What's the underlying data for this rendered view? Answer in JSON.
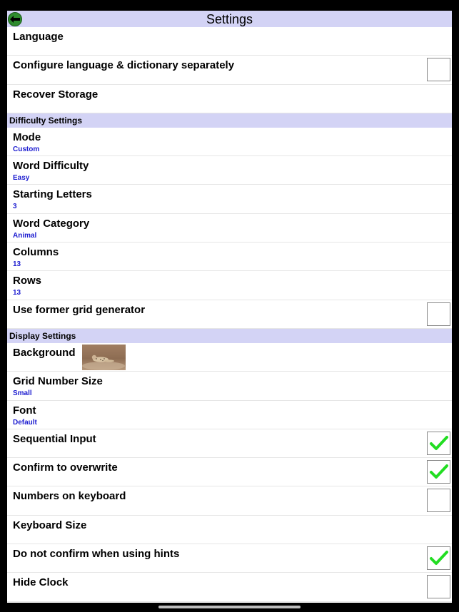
{
  "header": {
    "title": "Settings"
  },
  "sections": [
    {
      "header": "",
      "rows": [
        {
          "label": "Language"
        },
        {
          "label": "Configure language & dictionary separately",
          "checkbox": false
        },
        {
          "label": "Recover Storage"
        }
      ]
    },
    {
      "header": "Difficulty Settings",
      "rows": [
        {
          "label": "Mode",
          "value": "Custom"
        },
        {
          "label": "Word Difficulty",
          "value": "Easy"
        },
        {
          "label": "Starting Letters",
          "value": "3"
        },
        {
          "label": "Word Category",
          "value": "Animal"
        },
        {
          "label": "Columns",
          "value": "13"
        },
        {
          "label": "Rows",
          "value": "13"
        },
        {
          "label": "Use former grid generator",
          "checkbox": false
        }
      ]
    },
    {
      "header": "Display Settings",
      "rows": [
        {
          "label": "Background",
          "thumbnail": "cheetah-image"
        },
        {
          "label": "Grid Number Size",
          "value": "Small"
        },
        {
          "label": "Font",
          "value": "Default"
        },
        {
          "label": "Sequential Input",
          "checkbox": true
        },
        {
          "label": "Confirm to overwrite",
          "checkbox": true
        },
        {
          "label": "Numbers on keyboard",
          "checkbox": false
        },
        {
          "label": "Keyboard Size"
        },
        {
          "label": "Do not confirm when using hints",
          "checkbox": true
        },
        {
          "label": "Hide Clock",
          "checkbox": false
        }
      ]
    }
  ],
  "colors": {
    "header_bg": "#d3d3f5",
    "value_text": "#1d1dd0",
    "check": "#22dd22",
    "back_button": "#2e8b2e"
  },
  "icons": {
    "back": "back-arrow-icon",
    "check": "checkmark-icon"
  }
}
